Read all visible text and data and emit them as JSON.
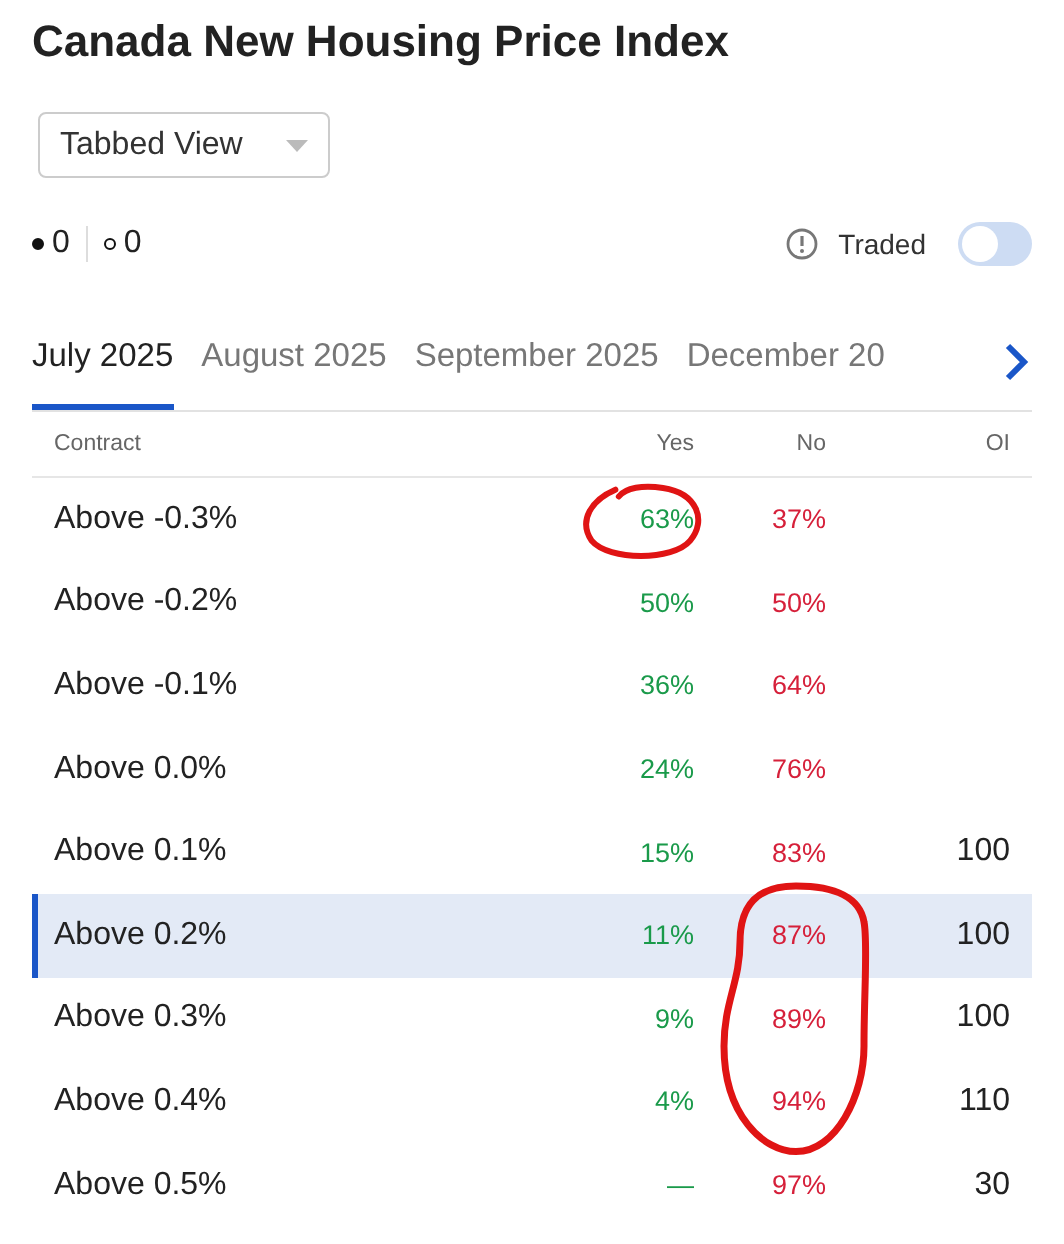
{
  "title": "Canada New Housing Price Index",
  "view_select": {
    "value": "Tabbed View"
  },
  "counts": [
    {
      "kind": "filled",
      "value": "0"
    },
    {
      "kind": "hollow",
      "value": "0"
    }
  ],
  "traded": {
    "label": "Traded",
    "on": false
  },
  "tabs": [
    {
      "label": "July 2025",
      "selected": true
    },
    {
      "label": "August 2025",
      "selected": false
    },
    {
      "label": "September 2025",
      "selected": false
    },
    {
      "label": "December 20",
      "selected": false
    }
  ],
  "table": {
    "columns": [
      "Contract",
      "Yes",
      "No",
      "OI"
    ],
    "rows": [
      {
        "contract": "Above -0.3%",
        "yes": "63%",
        "no": "37%",
        "selected": false,
        "yes_circled": true,
        "no_circled": false
      },
      {
        "contract": "Above -0.2%",
        "yes": "50%",
        "no": "50%",
        "selected": false,
        "yes_circled": false,
        "no_circled": false
      },
      {
        "contract": "Above -0.1%",
        "yes": "36%",
        "no": "64%",
        "selected": false,
        "yes_circled": false,
        "no_circled": false
      },
      {
        "contract": "Above 0.0%",
        "yes": "24%",
        "no": "76%",
        "selected": false,
        "yes_circled": false,
        "no_circled": false
      },
      {
        "contract": "Above 0.1%",
        "yes": "15%",
        "no": "83%",
        "oi": "100",
        "selected": false,
        "yes_circled": false,
        "no_circled": false
      },
      {
        "contract": "Above 0.2%",
        "yes": "11%",
        "no": "87%",
        "oi": "100",
        "selected": true,
        "yes_circled": false,
        "no_circled": true
      },
      {
        "contract": "Above 0.3%",
        "yes": "9%",
        "no": "89%",
        "oi": "100",
        "selected": false,
        "yes_circled": false,
        "no_circled": true
      },
      {
        "contract": "Above 0.4%",
        "yes": "4%",
        "no": "94%",
        "oi": "110",
        "selected": false,
        "yes_circled": false,
        "no_circled": true
      },
      {
        "contract": "Above 0.5%",
        "yes": "—",
        "no": "97%",
        "oi": "30",
        "selected": false,
        "yes_circled": false,
        "no_circled": false
      }
    ]
  }
}
